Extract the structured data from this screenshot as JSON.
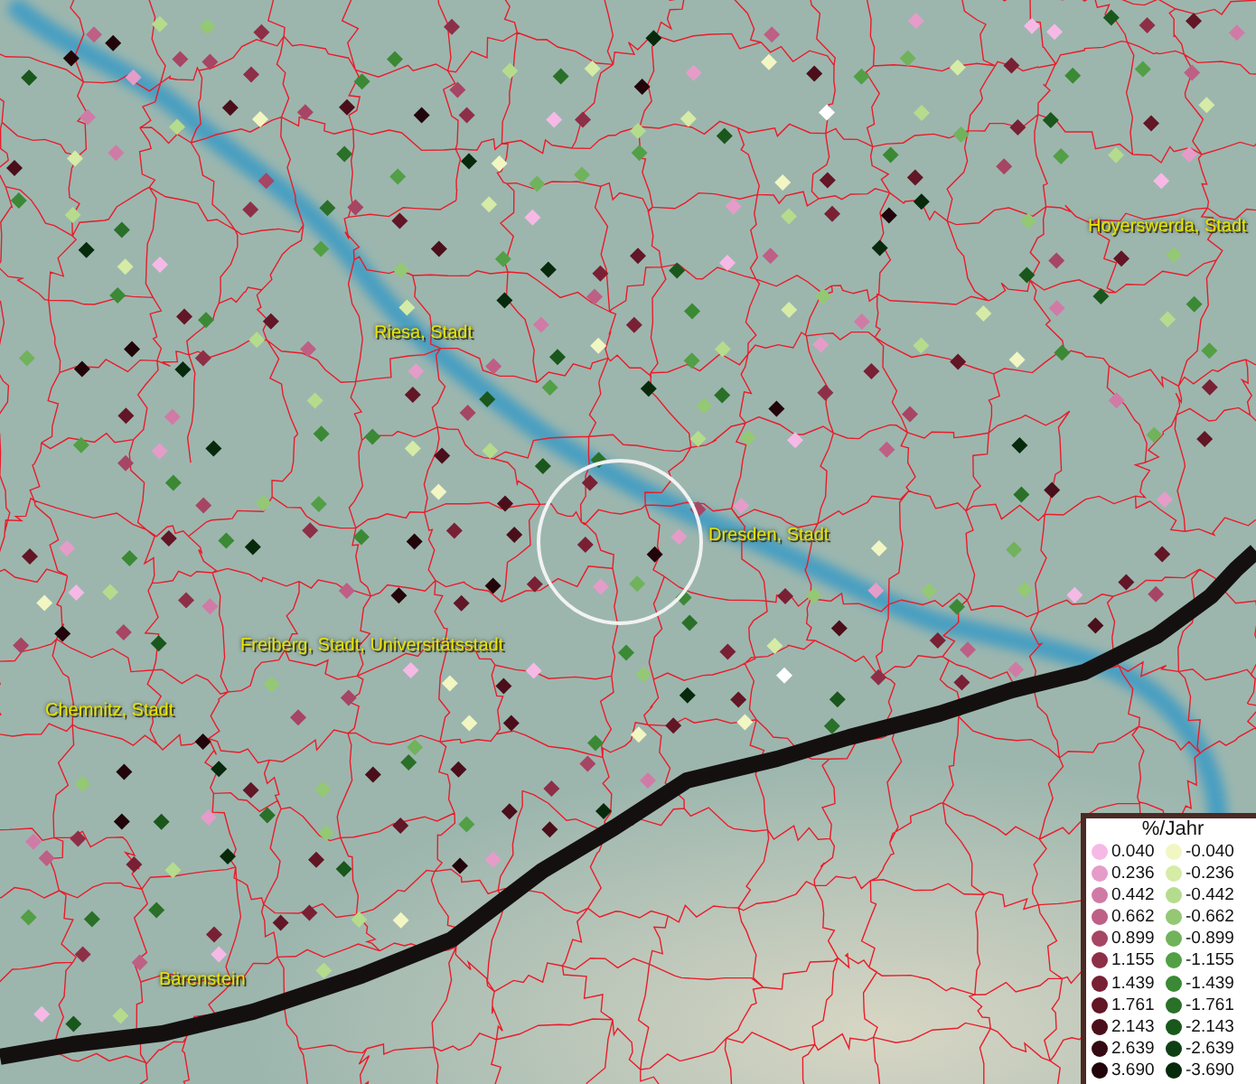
{
  "map": {
    "place_labels": [
      {
        "text": "Hoyerswerda, Stadt"
      },
      {
        "text": "Riesa, Stadt"
      },
      {
        "text": "Dresden, Stadt"
      },
      {
        "text": "Freiberg, Stadt, Universitätsstadt"
      },
      {
        "text": "Chemnitz, Stadt"
      },
      {
        "text": "Bärenstein"
      }
    ]
  },
  "legend": {
    "title": "%/Jahr",
    "rows": [
      {
        "left": {
          "value": "0.040",
          "color": "#f6b9e6"
        },
        "right": {
          "value": "-0.040",
          "color": "#f2f6c2"
        }
      },
      {
        "left": {
          "value": "0.236",
          "color": "#e69cc9"
        },
        "right": {
          "value": "-0.236",
          "color": "#d5eba6"
        }
      },
      {
        "left": {
          "value": "0.442",
          "color": "#d07ba6"
        },
        "right": {
          "value": "-0.442",
          "color": "#b5dc8c"
        }
      },
      {
        "left": {
          "value": "0.662",
          "color": "#be5f86"
        },
        "right": {
          "value": "-0.662",
          "color": "#94c874"
        }
      },
      {
        "left": {
          "value": "0.899",
          "color": "#a74564"
        },
        "right": {
          "value": "-0.899",
          "color": "#71b25c"
        }
      },
      {
        "left": {
          "value": "1.155",
          "color": "#8e2f48"
        },
        "right": {
          "value": "-1.155",
          "color": "#539f45"
        }
      },
      {
        "left": {
          "value": "1.439",
          "color": "#792035"
        },
        "right": {
          "value": "-1.439",
          "color": "#3b8935"
        }
      },
      {
        "left": {
          "value": "1.761",
          "color": "#621626"
        },
        "right": {
          "value": "-1.761",
          "color": "#2a7028"
        }
      },
      {
        "left": {
          "value": "2.143",
          "color": "#4a0f1a"
        },
        "right": {
          "value": "-2.143",
          "color": "#1a571c"
        }
      },
      {
        "left": {
          "value": "2.639",
          "color": "#360a12"
        },
        "right": {
          "value": "-2.639",
          "color": "#0f4014"
        }
      },
      {
        "left": {
          "value": "3.690",
          "color": "#22050a"
        },
        "right": {
          "value": "-3.690",
          "color": "#072a0c"
        }
      }
    ]
  }
}
